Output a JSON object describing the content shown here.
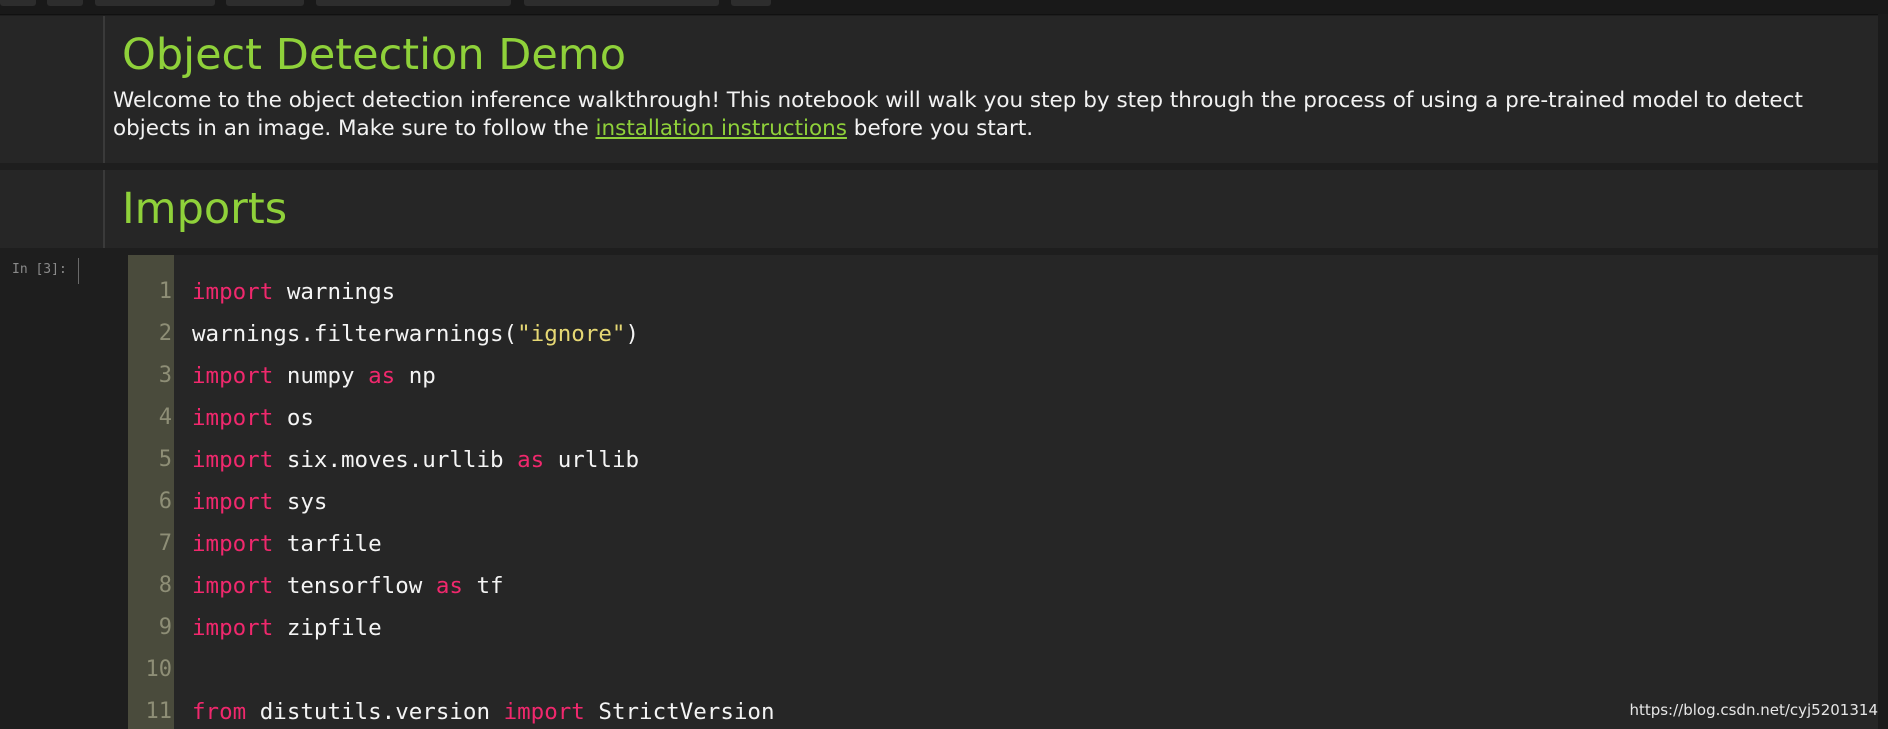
{
  "header": {
    "heading": "Object Detection Demo",
    "intro_before_link": "Welcome to the object detection inference walkthrough! This notebook will walk you step by step through the process of using a pre-trained model to detect objects in an image. Make sure to follow the ",
    "link_text": "installation instructions",
    "intro_after_link": " before you start."
  },
  "imports_cell": {
    "heading": "Imports"
  },
  "code_cell": {
    "prompt": "In [3]:",
    "line_numbers": [
      "1",
      "2",
      "3",
      "4",
      "5",
      "6",
      "7",
      "8",
      "9",
      "10",
      "11"
    ],
    "lines": [
      [
        {
          "t": "import",
          "k": "kw"
        },
        {
          "t": " warnings",
          "k": "plain"
        }
      ],
      [
        {
          "t": "warnings.filterwarnings(",
          "k": "plain"
        },
        {
          "t": "\"ignore\"",
          "k": "str"
        },
        {
          "t": ")",
          "k": "plain"
        }
      ],
      [
        {
          "t": "import",
          "k": "kw"
        },
        {
          "t": " numpy ",
          "k": "plain"
        },
        {
          "t": "as",
          "k": "kw"
        },
        {
          "t": " np",
          "k": "plain"
        }
      ],
      [
        {
          "t": "import",
          "k": "kw"
        },
        {
          "t": " os",
          "k": "plain"
        }
      ],
      [
        {
          "t": "import",
          "k": "kw"
        },
        {
          "t": " six.moves.urllib ",
          "k": "plain"
        },
        {
          "t": "as",
          "k": "kw"
        },
        {
          "t": " urllib",
          "k": "plain"
        }
      ],
      [
        {
          "t": "import",
          "k": "kw"
        },
        {
          "t": " sys",
          "k": "plain"
        }
      ],
      [
        {
          "t": "import",
          "k": "kw"
        },
        {
          "t": " tarfile",
          "k": "plain"
        }
      ],
      [
        {
          "t": "import",
          "k": "kw"
        },
        {
          "t": " tensorflow ",
          "k": "plain"
        },
        {
          "t": "as",
          "k": "kw"
        },
        {
          "t": " tf",
          "k": "plain"
        }
      ],
      [
        {
          "t": "import",
          "k": "kw"
        },
        {
          "t": " zipfile",
          "k": "plain"
        }
      ],
      [],
      [
        {
          "t": "from",
          "k": "kw"
        },
        {
          "t": " distutils.version ",
          "k": "plain"
        },
        {
          "t": "import",
          "k": "kw"
        },
        {
          "t": " StrictVersion",
          "k": "plain"
        }
      ]
    ]
  },
  "watermark": "https://blog.csdn.net/cyj5201314",
  "colors": {
    "background": "#1e1e1e",
    "cell_background": "#262626",
    "heading": "#8fd13a",
    "keyword": "#f0286d",
    "string": "#e6d874",
    "gutter": "#4a4b3c"
  }
}
